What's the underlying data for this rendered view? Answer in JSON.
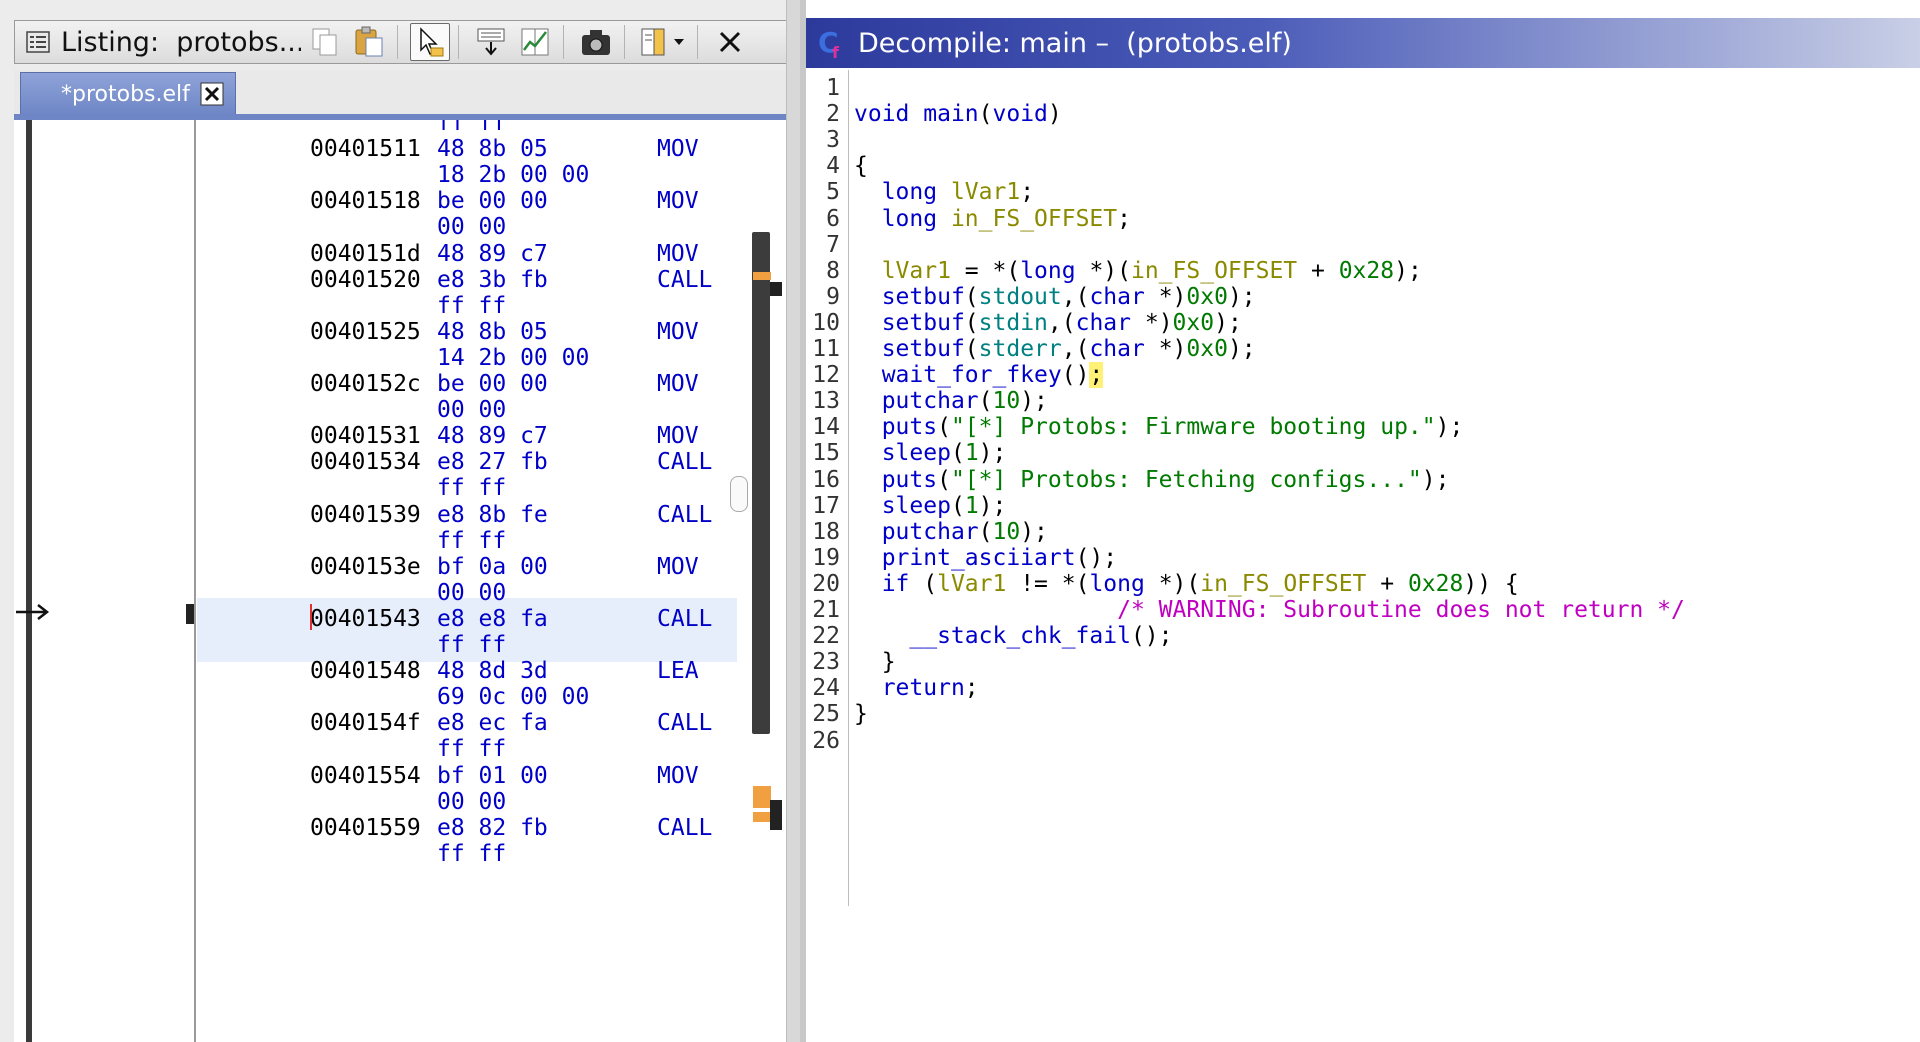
{
  "listing": {
    "title": "Listing:  protobs....",
    "tab_label": "*protobs.elf",
    "toolbar": [
      {
        "name": "copy-icon"
      },
      {
        "name": "paste-icon"
      },
      {
        "name": "cursor-select-icon",
        "selected": true
      },
      {
        "name": "field-navigator-icon"
      },
      {
        "name": "diff-view-icon"
      },
      {
        "name": "snapshot-camera-icon"
      },
      {
        "name": "layout-menu-icon"
      },
      {
        "name": "close-icon"
      }
    ],
    "rows": [
      {
        "addr": "",
        "bytes": "ff ff",
        "mnem": ""
      },
      {
        "addr": "00401511",
        "bytes": "48 8b 05",
        "mnem": "MOV"
      },
      {
        "addr": "",
        "bytes": "18 2b 00 00",
        "mnem": ""
      },
      {
        "addr": "00401518",
        "bytes": "be 00 00",
        "mnem": "MOV"
      },
      {
        "addr": "",
        "bytes": "00 00",
        "mnem": ""
      },
      {
        "addr": "0040151d",
        "bytes": "48 89 c7",
        "mnem": "MOV"
      },
      {
        "addr": "00401520",
        "bytes": "e8 3b fb",
        "mnem": "CALL"
      },
      {
        "addr": "",
        "bytes": "ff ff",
        "mnem": ""
      },
      {
        "addr": "00401525",
        "bytes": "48 8b 05",
        "mnem": "MOV"
      },
      {
        "addr": "",
        "bytes": "14 2b 00 00",
        "mnem": ""
      },
      {
        "addr": "0040152c",
        "bytes": "be 00 00",
        "mnem": "MOV"
      },
      {
        "addr": "",
        "bytes": "00 00",
        "mnem": ""
      },
      {
        "addr": "00401531",
        "bytes": "48 89 c7",
        "mnem": "MOV"
      },
      {
        "addr": "00401534",
        "bytes": "e8 27 fb",
        "mnem": "CALL"
      },
      {
        "addr": "",
        "bytes": "ff ff",
        "mnem": ""
      },
      {
        "addr": "00401539",
        "bytes": "e8 8b fe",
        "mnem": "CALL"
      },
      {
        "addr": "",
        "bytes": "ff ff",
        "mnem": ""
      },
      {
        "addr": "0040153e",
        "bytes": "bf 0a 00",
        "mnem": "MOV"
      },
      {
        "addr": "",
        "bytes": "00 00",
        "mnem": ""
      },
      {
        "addr": "00401543",
        "bytes": "e8 e8 fa",
        "mnem": "CALL"
      },
      {
        "addr": "",
        "bytes": "ff ff",
        "mnem": ""
      },
      {
        "addr": "00401548",
        "bytes": "48 8d 3d",
        "mnem": "LEA"
      },
      {
        "addr": "",
        "bytes": "69 0c 00 00",
        "mnem": ""
      },
      {
        "addr": "0040154f",
        "bytes": "e8 ec fa",
        "mnem": "CALL"
      },
      {
        "addr": "",
        "bytes": "ff ff",
        "mnem": ""
      },
      {
        "addr": "00401554",
        "bytes": "bf 01 00",
        "mnem": "MOV"
      },
      {
        "addr": "",
        "bytes": "00 00",
        "mnem": ""
      },
      {
        "addr": "00401559",
        "bytes": "e8 82 fb",
        "mnem": "CALL"
      },
      {
        "addr": "",
        "bytes": "ff ff",
        "mnem": ""
      }
    ]
  },
  "decompile": {
    "title": "Decompile: main –  (protobs.elf)",
    "lines": [
      {
        "n": "1",
        "tokens": []
      },
      {
        "n": "2",
        "tokens": [
          {
            "t": "void",
            "c": "tp"
          },
          {
            "t": " ",
            "c": "pc"
          },
          {
            "t": "main",
            "c": "fn"
          },
          {
            "t": "(",
            "c": "pc"
          },
          {
            "t": "void",
            "c": "tp"
          },
          {
            "t": ")",
            "c": "pc"
          }
        ]
      },
      {
        "n": "3",
        "tokens": []
      },
      {
        "n": "4",
        "tokens": [
          {
            "t": "{",
            "c": "pc"
          }
        ]
      },
      {
        "n": "5",
        "tokens": [
          {
            "t": "  ",
            "c": "pc"
          },
          {
            "t": "long",
            "c": "tp"
          },
          {
            "t": " ",
            "c": "pc"
          },
          {
            "t": "lVar1",
            "c": "vr"
          },
          {
            "t": ";",
            "c": "pc"
          }
        ]
      },
      {
        "n": "6",
        "tokens": [
          {
            "t": "  ",
            "c": "pc"
          },
          {
            "t": "long",
            "c": "tp"
          },
          {
            "t": " ",
            "c": "pc"
          },
          {
            "t": "in_FS_OFFSET",
            "c": "vr"
          },
          {
            "t": ";",
            "c": "pc"
          }
        ]
      },
      {
        "n": "7",
        "tokens": []
      },
      {
        "n": "8",
        "tokens": [
          {
            "t": "  ",
            "c": "pc"
          },
          {
            "t": "lVar1",
            "c": "vr"
          },
          {
            "t": " = *(",
            "c": "pc"
          },
          {
            "t": "long",
            "c": "tp"
          },
          {
            "t": " *)(",
            "c": "pc"
          },
          {
            "t": "in_FS_OFFSET",
            "c": "vr"
          },
          {
            "t": " + ",
            "c": "pc"
          },
          {
            "t": "0x28",
            "c": "nm"
          },
          {
            "t": ");",
            "c": "pc"
          }
        ]
      },
      {
        "n": "9",
        "tokens": [
          {
            "t": "  ",
            "c": "pc"
          },
          {
            "t": "setbuf",
            "c": "fn"
          },
          {
            "t": "(",
            "c": "pc"
          },
          {
            "t": "stdout",
            "c": "gl"
          },
          {
            "t": ",(",
            "c": "pc"
          },
          {
            "t": "char",
            "c": "tp"
          },
          {
            "t": " *)",
            "c": "pc"
          },
          {
            "t": "0x0",
            "c": "nm"
          },
          {
            "t": ");",
            "c": "pc"
          }
        ]
      },
      {
        "n": "10",
        "tokens": [
          {
            "t": "  ",
            "c": "pc"
          },
          {
            "t": "setbuf",
            "c": "fn"
          },
          {
            "t": "(",
            "c": "pc"
          },
          {
            "t": "stdin",
            "c": "gl"
          },
          {
            "t": ",(",
            "c": "pc"
          },
          {
            "t": "char",
            "c": "tp"
          },
          {
            "t": " *)",
            "c": "pc"
          },
          {
            "t": "0x0",
            "c": "nm"
          },
          {
            "t": ");",
            "c": "pc"
          }
        ]
      },
      {
        "n": "11",
        "tokens": [
          {
            "t": "  ",
            "c": "pc"
          },
          {
            "t": "setbuf",
            "c": "fn"
          },
          {
            "t": "(",
            "c": "pc"
          },
          {
            "t": "stderr",
            "c": "gl"
          },
          {
            "t": ",(",
            "c": "pc"
          },
          {
            "t": "char",
            "c": "tp"
          },
          {
            "t": " *)",
            "c": "pc"
          },
          {
            "t": "0x0",
            "c": "nm"
          },
          {
            "t": ");",
            "c": "pc"
          }
        ]
      },
      {
        "n": "12",
        "tokens": [
          {
            "t": "  ",
            "c": "pc"
          },
          {
            "t": "wait_for_fkey",
            "c": "fn"
          },
          {
            "t": "()",
            "c": "pc"
          },
          {
            "t": ";",
            "c": "hl"
          }
        ]
      },
      {
        "n": "13",
        "tokens": [
          {
            "t": "  ",
            "c": "pc"
          },
          {
            "t": "putchar",
            "c": "fn"
          },
          {
            "t": "(",
            "c": "pc"
          },
          {
            "t": "10",
            "c": "nm"
          },
          {
            "t": ");",
            "c": "pc"
          }
        ]
      },
      {
        "n": "14",
        "tokens": [
          {
            "t": "  ",
            "c": "pc"
          },
          {
            "t": "puts",
            "c": "fn"
          },
          {
            "t": "(",
            "c": "pc"
          },
          {
            "t": "\"[*] Protobs: Firmware booting up.\"",
            "c": "st"
          },
          {
            "t": ");",
            "c": "pc"
          }
        ]
      },
      {
        "n": "15",
        "tokens": [
          {
            "t": "  ",
            "c": "pc"
          },
          {
            "t": "sleep",
            "c": "fn"
          },
          {
            "t": "(",
            "c": "pc"
          },
          {
            "t": "1",
            "c": "nm"
          },
          {
            "t": ");",
            "c": "pc"
          }
        ]
      },
      {
        "n": "16",
        "tokens": [
          {
            "t": "  ",
            "c": "pc"
          },
          {
            "t": "puts",
            "c": "fn"
          },
          {
            "t": "(",
            "c": "pc"
          },
          {
            "t": "\"[*] Protobs: Fetching configs...\"",
            "c": "st"
          },
          {
            "t": ");",
            "c": "pc"
          }
        ]
      },
      {
        "n": "17",
        "tokens": [
          {
            "t": "  ",
            "c": "pc"
          },
          {
            "t": "sleep",
            "c": "fn"
          },
          {
            "t": "(",
            "c": "pc"
          },
          {
            "t": "1",
            "c": "nm"
          },
          {
            "t": ");",
            "c": "pc"
          }
        ]
      },
      {
        "n": "18",
        "tokens": [
          {
            "t": "  ",
            "c": "pc"
          },
          {
            "t": "putchar",
            "c": "fn"
          },
          {
            "t": "(",
            "c": "pc"
          },
          {
            "t": "10",
            "c": "nm"
          },
          {
            "t": ");",
            "c": "pc"
          }
        ]
      },
      {
        "n": "19",
        "tokens": [
          {
            "t": "  ",
            "c": "pc"
          },
          {
            "t": "print_asciiart",
            "c": "fn"
          },
          {
            "t": "();",
            "c": "pc"
          }
        ]
      },
      {
        "n": "20",
        "tokens": [
          {
            "t": "  ",
            "c": "pc"
          },
          {
            "t": "if",
            "c": "kw"
          },
          {
            "t": " (",
            "c": "pc"
          },
          {
            "t": "lVar1",
            "c": "vr"
          },
          {
            "t": " != *(",
            "c": "pc"
          },
          {
            "t": "long",
            "c": "tp"
          },
          {
            "t": " *)(",
            "c": "pc"
          },
          {
            "t": "in_FS_OFFSET",
            "c": "vr"
          },
          {
            "t": " + ",
            "c": "pc"
          },
          {
            "t": "0x28",
            "c": "nm"
          },
          {
            "t": ")) {",
            "c": "pc"
          }
        ]
      },
      {
        "n": "21",
        "tokens": [
          {
            "t": "                   ",
            "c": "pc"
          },
          {
            "t": "/* WARNING: Subroutine does not return */",
            "c": "cm"
          }
        ]
      },
      {
        "n": "22",
        "tokens": [
          {
            "t": "    ",
            "c": "pc"
          },
          {
            "t": "__stack_chk_fail",
            "c": "fn"
          },
          {
            "t": "();",
            "c": "pc"
          }
        ]
      },
      {
        "n": "23",
        "tokens": [
          {
            "t": "  }",
            "c": "pc"
          }
        ]
      },
      {
        "n": "24",
        "tokens": [
          {
            "t": "  ",
            "c": "pc"
          },
          {
            "t": "return",
            "c": "kw"
          },
          {
            "t": ";",
            "c": "pc"
          }
        ]
      },
      {
        "n": "25",
        "tokens": [
          {
            "t": "}",
            "c": "pc"
          }
        ]
      },
      {
        "n": "26",
        "tokens": []
      }
    ]
  },
  "colors": {
    "keyword": "#0000c8",
    "variable": "#8a8a00",
    "global": "#008080",
    "number": "#007a00",
    "string": "#007a00",
    "comment": "#c000c0",
    "highlight": "#fff176",
    "selection_row": "#e6eefb",
    "header_gradient_start": "#2c3a9c"
  }
}
